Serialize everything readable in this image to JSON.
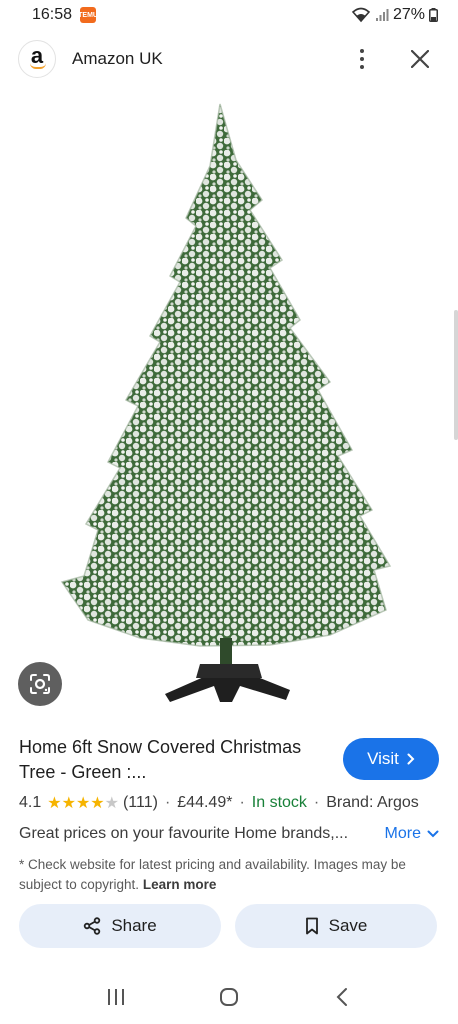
{
  "status_bar": {
    "time": "16:58",
    "notification_badge": "TEMU",
    "battery": "27%"
  },
  "header": {
    "site_letter": "a",
    "site_name": "Amazon UK"
  },
  "product": {
    "title": "Home 6ft Snow Covered Christmas Tree - Green :...",
    "visit_label": "Visit",
    "rating": "4.1",
    "rating_value": 4.1,
    "review_count": "(111)",
    "price": "£44.49*",
    "stock": "In stock",
    "brand": "Brand: Argos",
    "description": "Great prices on your favourite Home brands,...",
    "more_label": "More",
    "disclaimer": "* Check website for latest pricing and availability. Images may be subject to copyright.",
    "learn_more": "Learn more"
  },
  "actions": {
    "share_label": "Share",
    "save_label": "Save"
  },
  "colors": {
    "accent": "#1a73e8",
    "in_stock": "#188038",
    "star": "#f6b400",
    "action_bg": "#e7eef9"
  },
  "icons": [
    "wifi-icon",
    "signal-icon",
    "battery-icon",
    "more-vert-icon",
    "close-icon",
    "lens-icon",
    "chevron-right-icon",
    "chevron-down-icon",
    "share-icon",
    "bookmark-icon",
    "recents-icon",
    "home-icon",
    "back-icon"
  ]
}
